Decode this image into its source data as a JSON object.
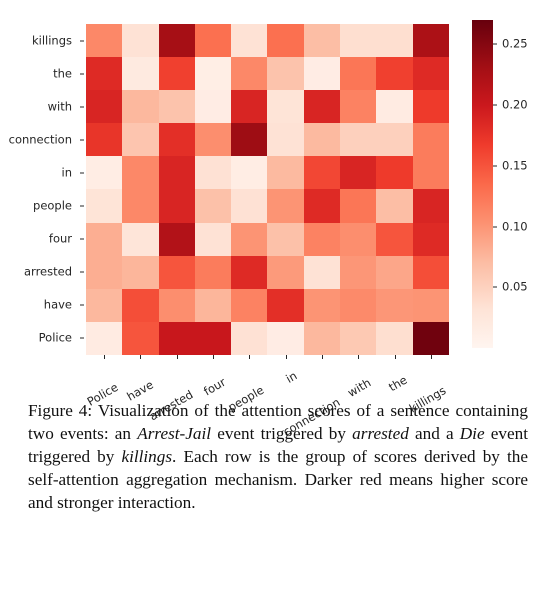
{
  "figure": {
    "caption_label": "Figure 4:",
    "caption_parts": {
      "p1": "Visualization of the attention scores of a sentence containing two events: an ",
      "i1": "Arrest-Jail",
      "p2": " event triggered by ",
      "i2": "arrested",
      "p3": " and a ",
      "i3": "Die",
      "p4": " event triggered by ",
      "i4": "killings",
      "p5": ". Each row is the group of scores derived by the self-attention aggregation mechanism. Darker red means higher score and stronger interaction."
    }
  },
  "colorbar": {
    "ticks": [
      "0.05",
      "0.10",
      "0.15",
      "0.20",
      "0.25"
    ],
    "vmin": 0.0,
    "vmax": 0.27,
    "colormap": "Reds",
    "low_color": "#fff5f0",
    "high_color": "#67000d"
  },
  "chart_data": {
    "type": "heatmap",
    "title": "",
    "xlabel": "",
    "ylabel": "",
    "colormap": "Reds",
    "grid": false,
    "legend_position": "right",
    "colorbar_label": "",
    "zlim": [
      0.0,
      0.27
    ],
    "x": [
      "Police",
      "have",
      "arrested",
      "four",
      "people",
      "in",
      "connection",
      "with",
      "the",
      "killings"
    ],
    "y": [
      "killings",
      "the",
      "with",
      "connection",
      "in",
      "people",
      "four",
      "arrested",
      "have",
      "Police"
    ],
    "values": [
      [
        0.11,
        0.03,
        0.235,
        0.13,
        0.03,
        0.13,
        0.065,
        0.035,
        0.035,
        0.23
      ],
      [
        0.185,
        0.018,
        0.165,
        0.012,
        0.11,
        0.06,
        0.014,
        0.125,
        0.165,
        0.185
      ],
      [
        0.19,
        0.07,
        0.06,
        0.014,
        0.19,
        0.028,
        0.19,
        0.115,
        0.016,
        0.17
      ],
      [
        0.175,
        0.058,
        0.18,
        0.105,
        0.24,
        0.03,
        0.068,
        0.048,
        0.048,
        0.12
      ],
      [
        0.013,
        0.11,
        0.19,
        0.032,
        0.013,
        0.068,
        0.16,
        0.19,
        0.17,
        0.12
      ],
      [
        0.028,
        0.11,
        0.19,
        0.062,
        0.032,
        0.1,
        0.185,
        0.125,
        0.065,
        0.19
      ],
      [
        0.078,
        0.026,
        0.225,
        0.03,
        0.1,
        0.062,
        0.115,
        0.105,
        0.15,
        0.185
      ],
      [
        0.078,
        0.072,
        0.15,
        0.12,
        0.185,
        0.095,
        0.03,
        0.098,
        0.085,
        0.155
      ],
      [
        0.07,
        0.155,
        0.105,
        0.072,
        0.115,
        0.18,
        0.1,
        0.108,
        0.098,
        0.1
      ],
      [
        0.016,
        0.15,
        0.205,
        0.205,
        0.032,
        0.014,
        0.07,
        0.055,
        0.035,
        0.265
      ]
    ]
  }
}
